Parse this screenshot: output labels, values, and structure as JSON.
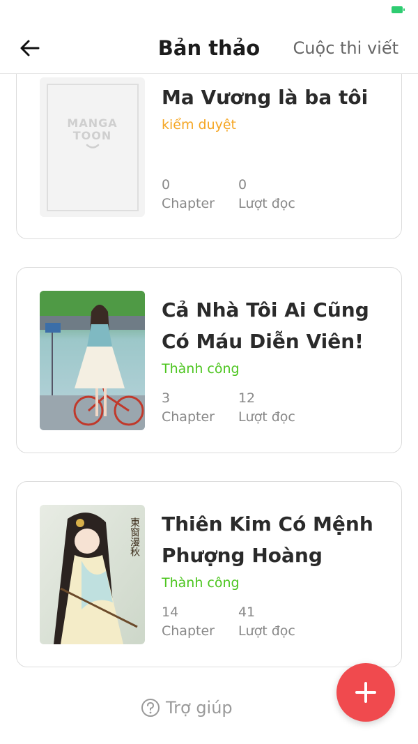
{
  "status_bar": {
    "battery_color": "#2ecc71",
    "battery_icon": "battery-charging-icon"
  },
  "header": {
    "back_icon": "arrow-left-icon",
    "title": "Bản thảo",
    "contest_link": "Cuộc thi viết"
  },
  "drafts": [
    {
      "title": "Ma Vương là ba tôi",
      "status": "kiểm duyệt",
      "status_color": "#f5a623",
      "cover": "mangatoon-placeholder-cover",
      "cover_logo_line1": "MANGA",
      "cover_logo_line2": "TOON",
      "chapters": "0",
      "chapters_label": "Chapter",
      "reads": "0",
      "reads_label": "Lượt đọc"
    },
    {
      "title": "Cả Nhà Tôi Ai Cũng Có Máu Diễn Viên!",
      "status": "Thành công",
      "status_color": "#4cc51f",
      "cover": "girl-with-bicycle-cover",
      "chapters": "3",
      "chapters_label": "Chapter",
      "reads": "12",
      "reads_label": "Lượt đọc"
    },
    {
      "title": "Thiên Kim Có Mệnh Phượng Hoàng",
      "status": "Thành công",
      "status_color": "#4cc51f",
      "cover": "hanfu-lady-cover",
      "cover_calligraphy": "東窗漫秋",
      "chapters": "14",
      "chapters_label": "Chapter",
      "reads": "41",
      "reads_label": "Lượt đọc"
    }
  ],
  "fab": {
    "icon": "plus-icon",
    "color": "#f04a4e"
  },
  "help": {
    "icon": "question-circle-icon",
    "label": "Trợ giúp"
  }
}
